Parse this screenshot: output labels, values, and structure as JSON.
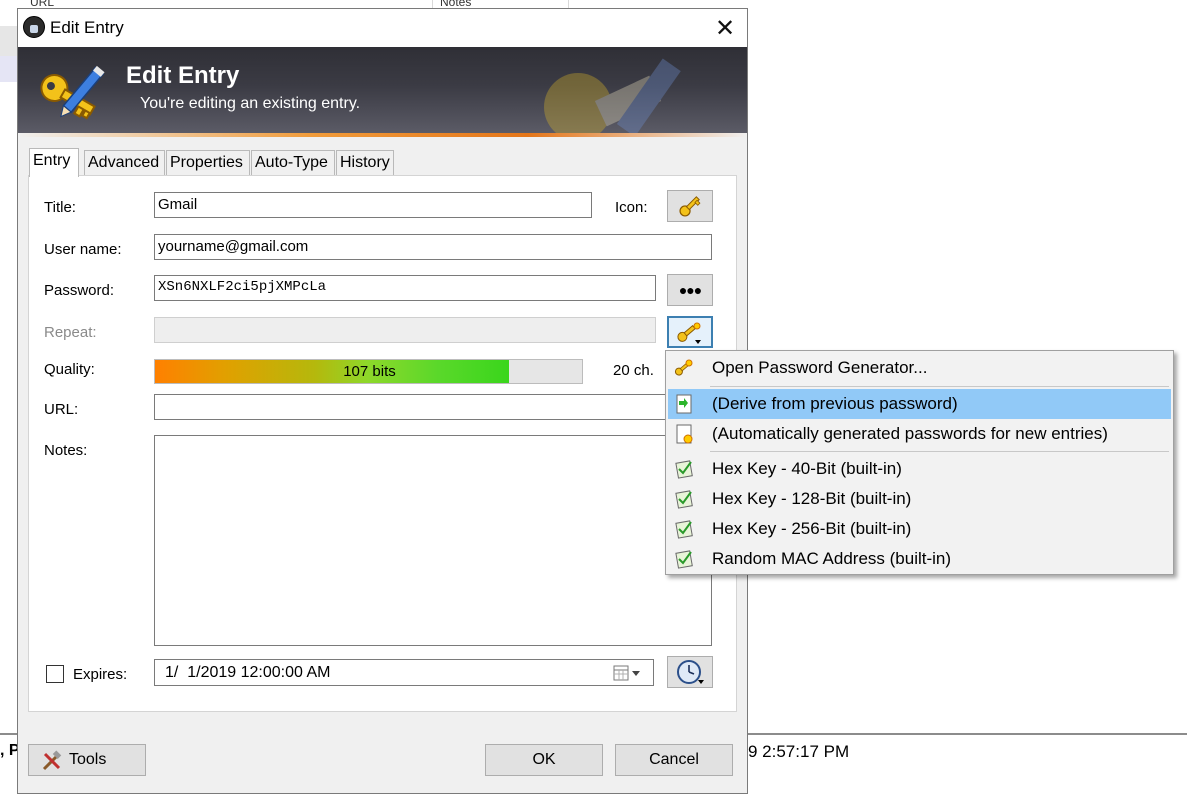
{
  "background": {
    "header_col_1": "URL",
    "header_col_2": "Notes",
    "status_left": ", P",
    "status_time": "9 2:57:17 PM"
  },
  "dialog": {
    "title": "Edit Entry",
    "banner_title": "Edit Entry",
    "banner_subtitle": "You're editing an existing entry.",
    "tabs": [
      "Entry",
      "Advanced",
      "Properties",
      "Auto-Type",
      "History"
    ],
    "active_tab": "Entry",
    "fields": {
      "title_label": "Title:",
      "title_value": "Gmail",
      "icon_label": "Icon:",
      "username_label": "User name:",
      "username_value": "yourname@gmail.com",
      "password_label": "Password:",
      "password_value": "XSn6NXLF2ci5pjXMPcLa",
      "repeat_label": "Repeat:",
      "repeat_value": "",
      "quality_label": "Quality:",
      "quality_text": "107 bits",
      "quality_fraction": 0.83,
      "quality_length": "20 ch.",
      "url_label": "URL:",
      "url_value": "",
      "notes_label": "Notes:",
      "notes_value": "",
      "expires_label": "Expires:",
      "expires_checked": false,
      "expires_value": "1/  1/2019 12:00:00 AM"
    },
    "buttons": {
      "show_password": "●●●",
      "tools": "Tools",
      "ok": "OK",
      "cancel": "Cancel"
    }
  },
  "generator_menu": {
    "items": [
      {
        "label": "Open Password Generator...",
        "icon": "password-generator-icon"
      },
      {
        "label": "(Derive from previous password)",
        "icon": "derive-icon",
        "highlighted": true
      },
      {
        "label": "(Automatically generated passwords for new entries)",
        "icon": "auto-generate-icon"
      },
      {
        "label": "Hex Key - 40-Bit (built-in)",
        "icon": "profile-icon"
      },
      {
        "label": "Hex Key - 128-Bit (built-in)",
        "icon": "profile-icon"
      },
      {
        "label": "Hex Key - 256-Bit (built-in)",
        "icon": "profile-icon"
      },
      {
        "label": "Random MAC Address (built-in)",
        "icon": "profile-icon"
      }
    ]
  },
  "colors": {
    "menu_highlight": "#91c9f7",
    "banner_dark": "#2f2f36",
    "quality_green": "#3ad61c",
    "quality_orange": "#ff8000"
  }
}
